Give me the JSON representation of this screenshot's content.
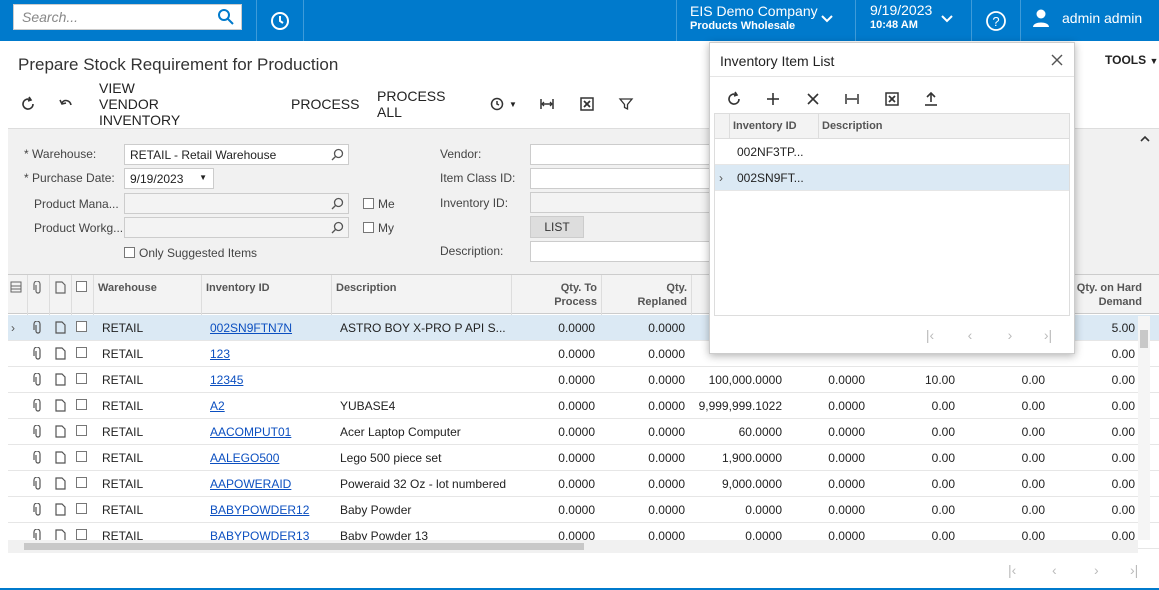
{
  "topbar": {
    "search_placeholder": "Search...",
    "company": "EIS Demo Company",
    "branch": "Products Wholesale",
    "date": "9/19/2023",
    "time": "10:48 AM",
    "user": "admin admin",
    "accent": "#007acc"
  },
  "page": {
    "title": "Prepare Stock Requirement for Production",
    "tools_label": "TOOLS"
  },
  "toolbar": {
    "view_vendor_inventory": "VIEW VENDOR INVENTORY",
    "process": "PROCESS",
    "process_all": "PROCESS ALL"
  },
  "filter": {
    "warehouse_label": "Warehouse:",
    "warehouse_value": "RETAIL - Retail Warehouse",
    "purchase_date_label": "Purchase Date:",
    "purchase_date_value": "9/19/2023",
    "product_manager_label": "Product Mana...",
    "product_workgroup_label": "Product Workg...",
    "me_label": "Me",
    "my_label": "My",
    "only_suggested_label": "Only Suggested Items",
    "vendor_label": "Vendor:",
    "item_class_label": "Item Class ID:",
    "inventory_id_label": "Inventory ID:",
    "list_button": "LIST",
    "description_label": "Description:"
  },
  "grid": {
    "columns": {
      "warehouse": "Warehouse",
      "inventory_id": "Inventory ID",
      "description": "Description",
      "qty_to_process_1": "Qty. To",
      "qty_to_process_2": "Process",
      "qty_replaned_1": "Qty.",
      "qty_replaned_2": "Replaned",
      "qty_hard_demand_1": "Qty. on Hard",
      "qty_hard_demand_2": "Demand"
    },
    "rows": [
      {
        "warehouse": "RETAIL",
        "inventory_id": "002SN9FTN7N",
        "description": "ASTRO BOY X-PRO P API S...",
        "qty_to_process": "0.0000",
        "qty_replaned": "0.0000",
        "c6": "",
        "c7": "",
        "c8": "",
        "c9": "",
        "c10": "5.00"
      },
      {
        "warehouse": "RETAIL",
        "inventory_id": "123",
        "description": "",
        "qty_to_process": "0.0000",
        "qty_replaned": "0.0000",
        "c6": "",
        "c7": "",
        "c8": "",
        "c9": "",
        "c10": "0.00"
      },
      {
        "warehouse": "RETAIL",
        "inventory_id": "12345",
        "description": "",
        "qty_to_process": "0.0000",
        "qty_replaned": "0.0000",
        "c6": "100,000.0000",
        "c7": "0.0000",
        "c8": "10.00",
        "c9": "0.00",
        "c10": "0.00"
      },
      {
        "warehouse": "RETAIL",
        "inventory_id": "A2",
        "description": "YUBASE4",
        "qty_to_process": "0.0000",
        "qty_replaned": "0.0000",
        "c6": "9,999,999.1022",
        "c7": "0.0000",
        "c8": "0.00",
        "c9": "0.00",
        "c10": "0.00"
      },
      {
        "warehouse": "RETAIL",
        "inventory_id": "AACOMPUT01",
        "description": "Acer Laptop Computer",
        "qty_to_process": "0.0000",
        "qty_replaned": "0.0000",
        "c6": "60.0000",
        "c7": "0.0000",
        "c8": "0.00",
        "c9": "0.00",
        "c10": "0.00"
      },
      {
        "warehouse": "RETAIL",
        "inventory_id": "AALEGO500",
        "description": "Lego 500 piece set",
        "qty_to_process": "0.0000",
        "qty_replaned": "0.0000",
        "c6": "1,900.0000",
        "c7": "0.0000",
        "c8": "0.00",
        "c9": "0.00",
        "c10": "0.00"
      },
      {
        "warehouse": "RETAIL",
        "inventory_id": "AAPOWERAID",
        "description": "Poweraid 32 Oz - lot numbered",
        "qty_to_process": "0.0000",
        "qty_replaned": "0.0000",
        "c6": "9,000.0000",
        "c7": "0.0000",
        "c8": "0.00",
        "c9": "0.00",
        "c10": "0.00"
      },
      {
        "warehouse": "RETAIL",
        "inventory_id": "BABYPOWDER12",
        "description": "Baby Powder",
        "qty_to_process": "0.0000",
        "qty_replaned": "0.0000",
        "c6": "0.0000",
        "c7": "0.0000",
        "c8": "0.00",
        "c9": "0.00",
        "c10": "0.00"
      },
      {
        "warehouse": "RETAIL",
        "inventory_id": "BABYPOWDER13",
        "description": "Baby Powder 13",
        "qty_to_process": "0.0000",
        "qty_replaned": "0.0000",
        "c6": "0.0000",
        "c7": "0.0000",
        "c8": "0.00",
        "c9": "0.00",
        "c10": "0.00"
      }
    ]
  },
  "popup": {
    "title": "Inventory Item List",
    "col_inventory_id": "Inventory ID",
    "col_description": "Description",
    "rows": [
      {
        "inventory_id": "002NF3TP...",
        "description": ""
      },
      {
        "inventory_id": "002SN9FT...",
        "description": ""
      }
    ]
  }
}
